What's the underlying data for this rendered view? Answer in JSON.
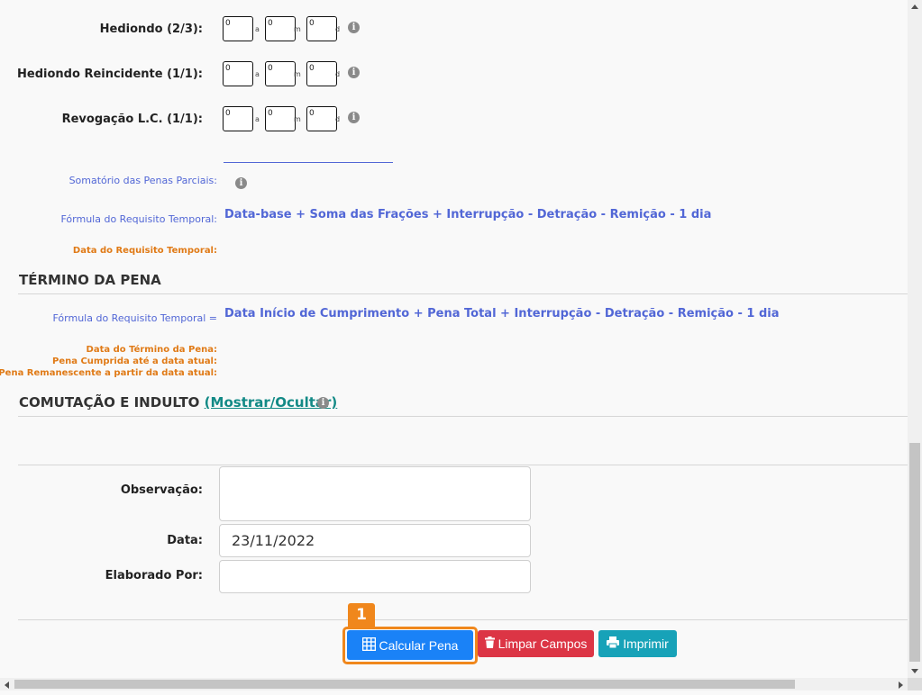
{
  "rows": [
    {
      "label": "Hediondo (2/3):",
      "years": "0",
      "months": "0",
      "days": "0"
    },
    {
      "label": "Hediondo Reincidente (1/1):",
      "years": "0",
      "months": "0",
      "days": "0"
    },
    {
      "label": "Revogação L.C. (1/1):",
      "years": "0",
      "months": "0",
      "days": "0"
    }
  ],
  "units": {
    "years": "a",
    "months": "m",
    "days": "d"
  },
  "info_glyph": "i",
  "requisito": {
    "somatorio_label": "Somatório das Penas Parciais:",
    "formula_label": "Fórmula do Requisito Temporal:",
    "formula_value": "Data-base + Soma das Frações + Interrupção - Detração - Remição - 1 dia",
    "data_label": "Data do Requisito Temporal:"
  },
  "termino": {
    "title": "TÉRMINO DA PENA",
    "formula_label": "Fórmula do Requisito Temporal =",
    "formula_value": "Data Início de Cumprimento + Pena Total + Interrupção - Detração - Remição - 1 dia",
    "data_termino_label": "Data do Término da Pena:",
    "pena_cumprida_label": "Pena Cumprida até a data atual:",
    "pena_remanescente_label": "Pena Remanescente a partir da data atual:"
  },
  "comutacao": {
    "title": "COMUTAÇÃO E INDULTO",
    "toggle_link": "(Mostrar/Ocultar)"
  },
  "form": {
    "observacao_label": "Observação:",
    "observacao_value": "",
    "data_label": "Data:",
    "data_value": "23/11/2022",
    "elaborado_label": "Elaborado Por:",
    "elaborado_value": ""
  },
  "buttons": {
    "calcular": "Calcular Pena",
    "limpar": "Limpar Campos",
    "imprimir": "Imprimir"
  },
  "step_marker": "1",
  "colors": {
    "accent_blue": "#5267d6",
    "accent_orange": "#e07a16",
    "btn_primary": "#1a82f7",
    "btn_danger": "#dc3545",
    "btn_info": "#17a2b8",
    "highlight": "#f0871c",
    "link": "#138a86"
  }
}
